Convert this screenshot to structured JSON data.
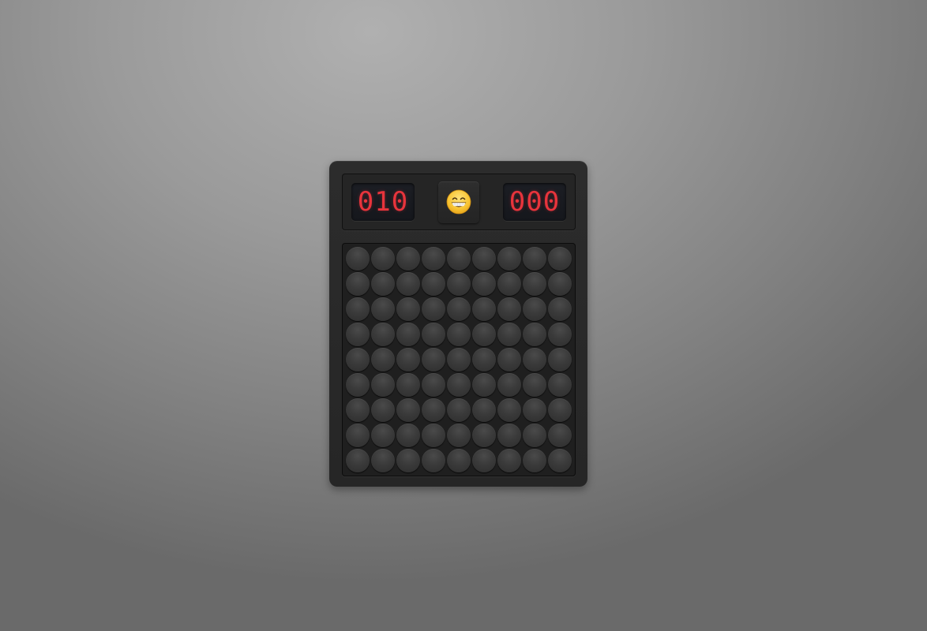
{
  "header": {
    "mines_remaining": "010",
    "timer": "000",
    "face_icon": "grinning-face-icon"
  },
  "board": {
    "rows": 9,
    "cols": 9,
    "state": "all-covered"
  },
  "colors": {
    "digit": "#e8343c",
    "panel": "#2a2a2a",
    "cell": "#3a3a3a"
  }
}
